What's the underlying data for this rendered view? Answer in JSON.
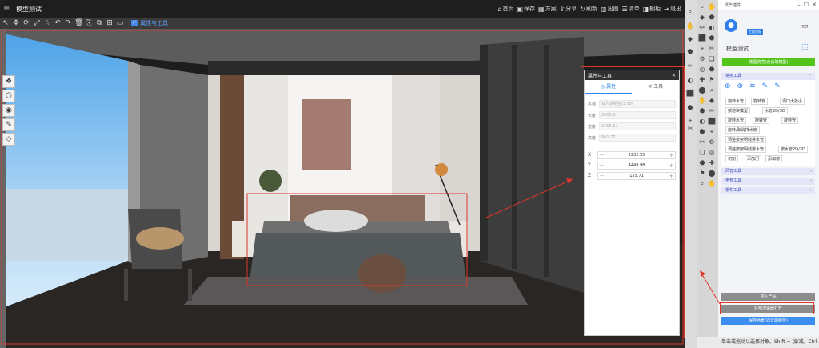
{
  "window": {
    "title": "模型测试"
  },
  "topnav": [
    {
      "icon": "home-icon",
      "glyph": "⌂",
      "label": "首页"
    },
    {
      "icon": "save-icon",
      "glyph": "▣",
      "label": "保存"
    },
    {
      "icon": "scheme-icon",
      "glyph": "▦",
      "label": "方案"
    },
    {
      "icon": "share-icon",
      "glyph": "⇪",
      "label": "分享"
    },
    {
      "icon": "refresh-icon",
      "glyph": "↻",
      "label": "刷新"
    },
    {
      "icon": "drawing-icon",
      "glyph": "▥",
      "label": "出图"
    },
    {
      "icon": "list-icon",
      "glyph": "☰",
      "label": "清单"
    },
    {
      "icon": "render-icon",
      "glyph": "◨",
      "label": "橱柜"
    },
    {
      "icon": "exit-icon",
      "glyph": "⇥",
      "label": "退出"
    }
  ],
  "toolbar": {
    "tools": [
      {
        "icon": "select-tool-icon",
        "glyph": "↖"
      },
      {
        "icon": "move-tool-icon",
        "glyph": "✥"
      },
      {
        "icon": "rotate-tool-icon",
        "glyph": "⟳"
      },
      {
        "icon": "scale-tool-icon",
        "glyph": "⤢"
      },
      {
        "icon": "star-icon",
        "glyph": "☆"
      },
      {
        "icon": "undo-icon",
        "glyph": "↶"
      },
      {
        "icon": "redo-icon",
        "glyph": "↷"
      },
      {
        "icon": "delete-icon",
        "glyph": "🗑"
      },
      {
        "icon": "copy-icon",
        "glyph": "⎘"
      },
      {
        "icon": "paste-icon",
        "glyph": "⧉"
      },
      {
        "icon": "grid-icon",
        "glyph": "⊞"
      },
      {
        "icon": "image-icon",
        "glyph": "▭"
      }
    ],
    "checkbox_label": "属性与工具"
  },
  "left_tools": [
    {
      "icon": "layers-tool-icon",
      "glyph": "❖"
    },
    {
      "icon": "box-tool-icon",
      "glyph": "⬡"
    },
    {
      "icon": "target-tool-icon",
      "glyph": "◉"
    },
    {
      "icon": "edit-tool-icon",
      "glyph": "✎"
    },
    {
      "icon": "stack-tool-icon",
      "glyph": "◇"
    }
  ],
  "properties": {
    "title": "属性与工具",
    "tabs": [
      "属性",
      "工具"
    ],
    "fields": [
      {
        "label": "名称",
        "value": "双人床组合/3.0f/f"
      },
      {
        "label": "长度",
        "value": "2005.0"
      },
      {
        "label": "宽度",
        "value": "2463.61"
      },
      {
        "label": "高度",
        "value": "861.77"
      }
    ],
    "coords": [
      {
        "label": "X",
        "value": "2232.55"
      },
      {
        "label": "Y",
        "value": "4449.98"
      },
      {
        "label": "Z",
        "value": "155.71"
      }
    ]
  },
  "plugin": {
    "title": "沃华插件",
    "user_badge": "工程坐标",
    "project": "模型测试",
    "green_button": "按图高亮(含云端模型)",
    "sections": {
      "common": "常用工具",
      "wind": "风管工具",
      "electric": "电管工具",
      "steel": "钢构工具"
    },
    "tool_buttons": [
      "旋转水管",
      "旋转管",
      "调口大批小",
      "按地块模型",
      "水管2D/3D",
      "旋转水管",
      "旋转管",
      "旋转管",
      "旋转/取消排水管",
      "调整按架明线排水管",
      "调整按架明线排水管",
      "按水管2D/3D",
      "切割",
      "添加门",
      "添加窗"
    ],
    "bottom_buttons": {
      "insert": "插入产品",
      "external": "外部渲染器打开",
      "save": "保存场景(同云端服务)"
    }
  },
  "status": {
    "text": "单击或拖动以选择对象。Shift = 加/减。Ctrl = 加"
  },
  "colors": {
    "accent_blue": "#2f80ed",
    "green": "#52c41a",
    "highlight_red": "#e0362c"
  }
}
